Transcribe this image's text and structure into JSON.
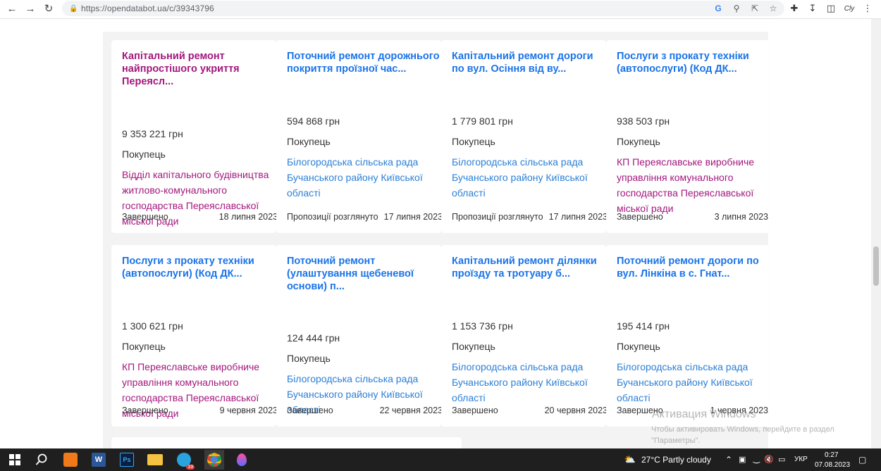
{
  "browser": {
    "url": "https://opendatabot.ua/c/39343796"
  },
  "cards_row1": [
    {
      "title": "Капітальний ремонт найпростішого укриття Переясл...",
      "title_color": "purple",
      "amount": "9 353 221 грн",
      "buyer_label": "Покупець",
      "buyer": "Відділ капітального будівництва житлово-комунального господарства Переяславської міської ради",
      "buyer_color": "purple",
      "status": "Завершено",
      "date": "18 липня 2023"
    },
    {
      "title": "Поточний ремонт дорожнього покриття проїзної час...",
      "title_color": "blue",
      "amount": "594 868 грн",
      "buyer_label": "Покупець",
      "buyer": "Білогородська сільська рада Бучанського району Київської області",
      "buyer_color": "blue",
      "status": "Пропозиції розглянуто",
      "date": "17 липня 2023"
    },
    {
      "title": "Капітальний ремонт дороги по вул. Осіння від ву...",
      "title_color": "blue",
      "amount": "1 779 801 грн",
      "buyer_label": "Покупець",
      "buyer": "Білогородська сільська рада Бучанського району Київської області",
      "buyer_color": "blue",
      "status": "Пропозиції розглянуто",
      "date": "17 липня 2023"
    },
    {
      "title": "Послуги з прокату техніки (автопослуги) (Код ДК...",
      "title_color": "blue",
      "amount": "938 503 грн",
      "buyer_label": "Покупець",
      "buyer": "КП Переяславське виробниче управління комунального господарства Переяславської міської ради",
      "buyer_color": "purple",
      "status": "Завершено",
      "date": "3 липня 2023"
    }
  ],
  "cards_row2": [
    {
      "title": "Послуги з прокату техніки (автопослуги) (Код ДК...",
      "title_color": "blue",
      "amount": "1 300 621 грн",
      "buyer_label": "Покупець",
      "buyer": "КП Переяславське виробниче управління комунального господарства Переяславської міської ради",
      "buyer_color": "purple",
      "status": "Завершено",
      "date": "9 червня 2023"
    },
    {
      "title": "Поточний ремонт (улаштування щебеневої основи) п...",
      "title_color": "blue",
      "amount": "124 444 грн",
      "buyer_label": "Покупець",
      "buyer": "Білогородська сільська рада Бучанського району Київської області",
      "buyer_color": "blue",
      "status": "Завершено",
      "date": "22 червня 2023"
    },
    {
      "title": "Капітальний ремонт ділянки проїзду та тротуару б...",
      "title_color": "blue",
      "amount": "1 153 736 грн",
      "buyer_label": "Покупець",
      "buyer": "Білогородська сільська рада Бучанського району Київської області",
      "buyer_color": "blue",
      "status": "Завершено",
      "date": "20 червня 2023"
    },
    {
      "title": "Поточний ремонт дороги по вул. Лінкіна в с. Гнат...",
      "title_color": "blue",
      "amount": "195 414 грн",
      "buyer_label": "Покупець",
      "buyer": "Білогородська сільська рада Бучанського району Київської області",
      "buyer_color": "blue",
      "status": "Завершено",
      "date": "1 червня 2023"
    }
  ],
  "watermark": {
    "line1": "Активация Windows",
    "line2": "Чтобы активировать Windows, перейдите в раздел \"Параметры\"."
  },
  "taskbar": {
    "weather": "27°C  Partly cloudy",
    "lang": "УКР",
    "time": "0:27",
    "date": "07.08.2023",
    "telegram_badge": "19"
  }
}
